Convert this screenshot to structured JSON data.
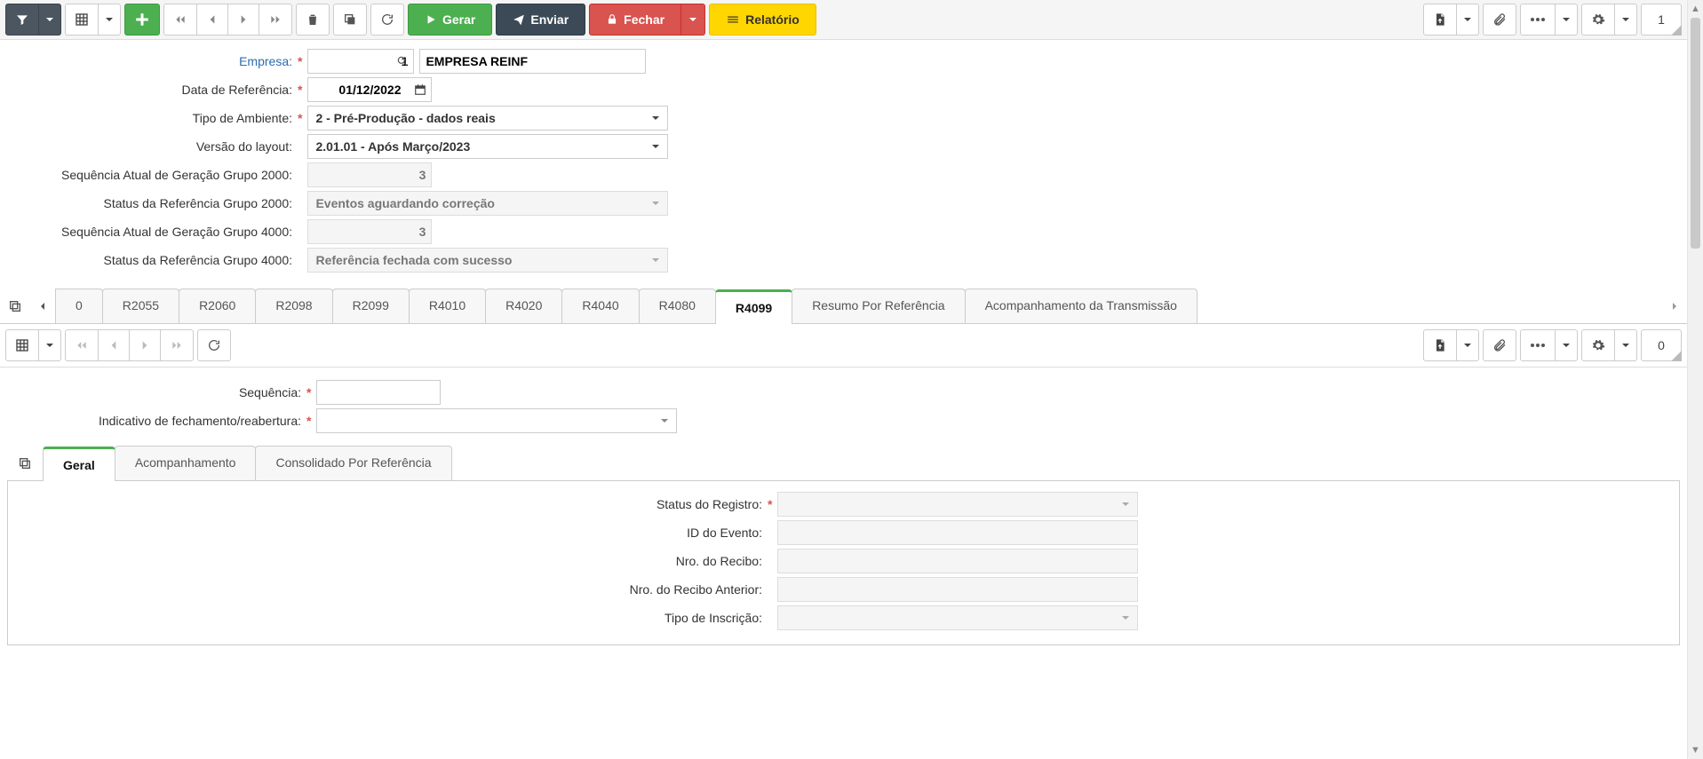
{
  "toolbar": {
    "gerar": "Gerar",
    "enviar": "Enviar",
    "fechar": "Fechar",
    "relatorio": "Relatório",
    "top_count": "1",
    "sub_count": "0"
  },
  "form": {
    "labels": {
      "empresa": "Empresa:",
      "data_referencia": "Data de Referência:",
      "tipo_ambiente": "Tipo de Ambiente:",
      "versao_layout": "Versão do layout:",
      "seq_2000": "Sequência Atual de Geração Grupo 2000:",
      "status_2000": "Status da Referência Grupo 2000:",
      "seq_4000": "Sequência Atual de Geração Grupo 4000:",
      "status_4000": "Status da Referência Grupo 4000:"
    },
    "empresa_code": "1",
    "empresa_name": "EMPRESA REINF",
    "data_referencia": "01/12/2022",
    "tipo_ambiente": "2 - Pré-Produção - dados reais",
    "versao_layout": "2.01.01 - Após Março/2023",
    "seq_2000": "3",
    "status_2000": "Eventos aguardando correção",
    "seq_4000": "3",
    "status_4000": "Referência fechada com sucesso"
  },
  "tabs": {
    "t0": "0",
    "r2055": "R2055",
    "r2060": "R2060",
    "r2098": "R2098",
    "r2099": "R2099",
    "r4010": "R4010",
    "r4020": "R4020",
    "r4040": "R4040",
    "r4080": "R4080",
    "r4099": "R4099",
    "resumo": "Resumo Por Referência",
    "acomp_trans": "Acompanhamento da Transmissão"
  },
  "inner_form": {
    "labels": {
      "sequencia": "Sequência:",
      "indic_fechamento": "Indicativo de fechamento/reabertura:"
    }
  },
  "inner_tabs": {
    "geral": "Geral",
    "acompanhamento": "Acompanhamento",
    "consolidado": "Consolidado Por Referência"
  },
  "geral": {
    "labels": {
      "status_registro": "Status do Registro:",
      "id_evento": "ID do Evento:",
      "nro_recibo": "Nro. do Recibo:",
      "nro_recibo_ant": "Nro. do Recibo Anterior:",
      "tipo_inscricao": "Tipo de Inscrição:"
    }
  }
}
